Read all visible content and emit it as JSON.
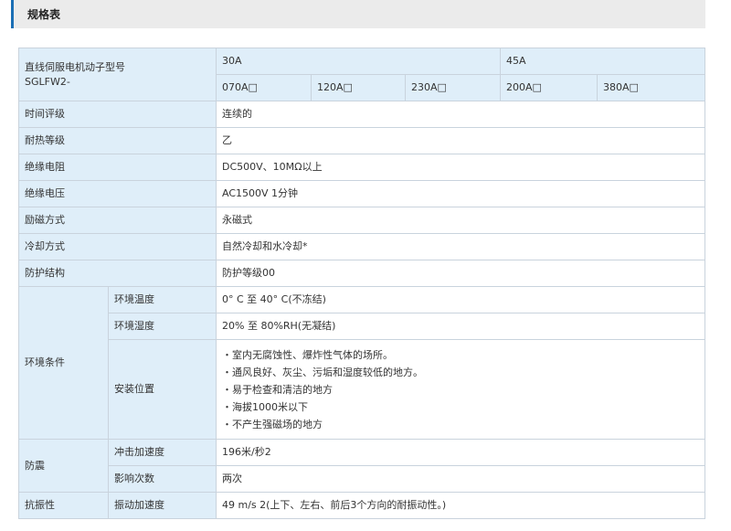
{
  "header": {
    "title": "规格表"
  },
  "model": {
    "label_line1": "直线伺服电机动子型号",
    "label_line2": "SGLFW2-",
    "group_30a": "30A",
    "group_45a": "45A",
    "sub": [
      "070A□",
      "120A□",
      "230A□",
      "200A□",
      "380A□"
    ]
  },
  "rows": {
    "time_rating": {
      "label": "时间评级",
      "value": "连续的"
    },
    "heat_class": {
      "label": "耐热等级",
      "value": "乙"
    },
    "insulation_resistance": {
      "label": "绝缘电阻",
      "value": "DC500V、10MΩ以上"
    },
    "insulation_voltage": {
      "label": "绝缘电压",
      "value": "AC1500V 1分钟"
    },
    "excitation": {
      "label": "励磁方式",
      "value": "永磁式"
    },
    "cooling": {
      "label": "冷却方式",
      "value": "自然冷却和水冷却*"
    },
    "protection": {
      "label": "防护结构",
      "value": "防护等级00"
    }
  },
  "env": {
    "label": "环境条件",
    "temp": {
      "label": "环境温度",
      "value": "0° C 至 40° C(不冻结)"
    },
    "humidity": {
      "label": "环境湿度",
      "value": "20% 至 80%RH(无凝结)"
    },
    "install": {
      "label": "安装位置",
      "items": [
        "室内无腐蚀性、爆炸性气体的场所。",
        "通风良好、灰尘、污垢和湿度较低的地方。",
        "易于检查和清洁的地方",
        "海拔1000米以下",
        "不产生强磁场的地方"
      ]
    }
  },
  "shock": {
    "label": "防震",
    "accel": {
      "label": "冲击加速度",
      "value": "196米/秒2"
    },
    "count": {
      "label": "影响次数",
      "value": "两次"
    }
  },
  "vibration": {
    "label": "抗振性",
    "accel": {
      "label": "振动加速度",
      "value": "49 m/s 2(上下、左右、前后3个方向的耐振动性。)"
    }
  },
  "colors": {
    "accent": "#1b6fb5",
    "label_bg": "#dfeef9",
    "border": "#c9d3dd",
    "header_bg": "#ebebeb"
  }
}
